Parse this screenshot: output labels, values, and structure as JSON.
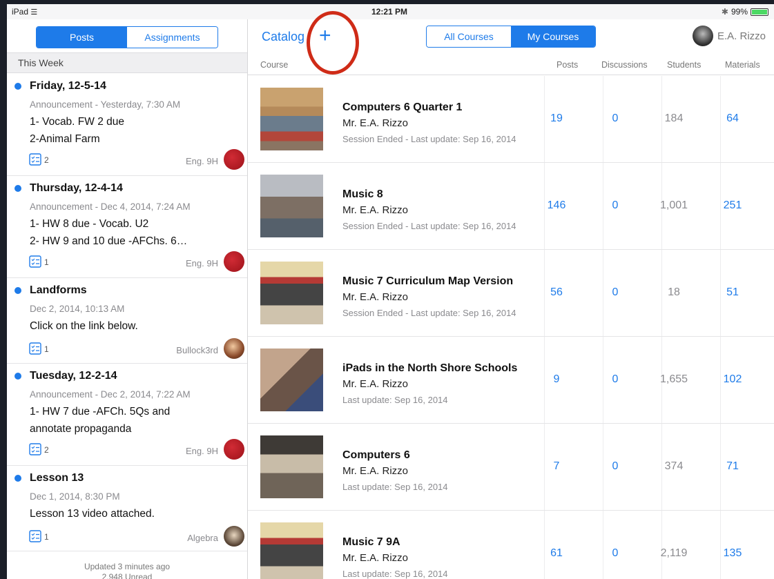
{
  "status_bar": {
    "device": "iPad",
    "time": "12:21 PM",
    "battery": "99%",
    "battery_level": 0.99
  },
  "left": {
    "tabs": [
      {
        "label": "Posts",
        "active": true
      },
      {
        "label": "Assignments",
        "active": false
      }
    ],
    "section_title": "This Week",
    "posts": [
      {
        "title": "Friday, 12-5-14",
        "meta": "Announcement - Yesterday, 7:30 AM",
        "lines": [
          "1- Vocab. FW 2 due",
          "2-Animal Farm"
        ],
        "count": "2",
        "course": "Eng. 9H"
      },
      {
        "title": "Thursday, 12-4-14",
        "meta": "Announcement - Dec 4, 2014, 7:24 AM",
        "lines": [
          "1- HW 8 due - Vocab. U2",
          "2- HW 9 and 10 due -AFChs. 6…"
        ],
        "count": "1",
        "course": "Eng. 9H"
      },
      {
        "title": "Landforms",
        "meta": "Dec 2, 2014, 10:13 AM",
        "lines": [
          "Click on the link below."
        ],
        "count": "1",
        "course": "Bullock3rd"
      },
      {
        "title": "Tuesday, 12-2-14",
        "meta": "Announcement - Dec 2, 2014, 7:22 AM",
        "lines": [
          "1- HW 7 due -AFCh. 5Qs and",
          "annotate propaganda"
        ],
        "count": "2",
        "course": "Eng. 9H"
      },
      {
        "title": "Lesson 13",
        "meta": "Dec 1, 2014, 8:30 PM",
        "lines": [
          "Lesson 13 video attached."
        ],
        "count": "1",
        "course": "Algebra"
      }
    ],
    "footer": {
      "updated": "Updated 3 minutes ago",
      "unread": "2,948 Unread"
    }
  },
  "right": {
    "catalog_label": "Catalog",
    "add_symbol": "+",
    "tabs": [
      {
        "label": "All Courses",
        "active": false
      },
      {
        "label": "My Courses",
        "active": true
      }
    ],
    "user_name": "E.A. Rizzo",
    "columns": {
      "course": "Course",
      "posts": "Posts",
      "discussions": "Discussions",
      "students": "Students",
      "materials": "Materials"
    },
    "courses": [
      {
        "name": "Computers 6 Quarter 1",
        "teacher": "Mr. E.A. Rizzo",
        "status": "Session Ended",
        "update": "Last update: Sep 16, 2014",
        "posts": "19",
        "discussions": "0",
        "students": "184",
        "materials": "64"
      },
      {
        "name": "Music 8",
        "teacher": "Mr. E.A. Rizzo",
        "status": "Session Ended",
        "update": "Last update: Sep 16, 2014",
        "posts": "146",
        "discussions": "0",
        "students": "1,001",
        "materials": "251"
      },
      {
        "name": "Music 7 Curriculum Map Version",
        "teacher": "Mr. E.A. Rizzo",
        "status": "Session Ended",
        "update": "Last update: Sep 16, 2014",
        "posts": "56",
        "discussions": "0",
        "students": "18",
        "materials": "51"
      },
      {
        "name": "iPads in the North Shore Schools",
        "teacher": "Mr. E.A. Rizzo",
        "status": "",
        "update": "Last update: Sep 16, 2014",
        "posts": "9",
        "discussions": "0",
        "students": "1,655",
        "materials": "102"
      },
      {
        "name": "Computers 6",
        "teacher": "Mr. E.A. Rizzo",
        "status": "",
        "update": "Last update: Sep 16, 2014",
        "posts": "7",
        "discussions": "0",
        "students": "374",
        "materials": "71"
      },
      {
        "name": "Music 7 9A",
        "teacher": "Mr. E.A. Rizzo",
        "status": "",
        "update": "Last update: Sep 16, 2014",
        "posts": "61",
        "discussions": "0",
        "students": "2,119",
        "materials": "135"
      }
    ]
  },
  "colors": {
    "accent": "#1e7be9",
    "highlight_ring": "#cf2b17",
    "unread_dot": "#1e7be9"
  }
}
